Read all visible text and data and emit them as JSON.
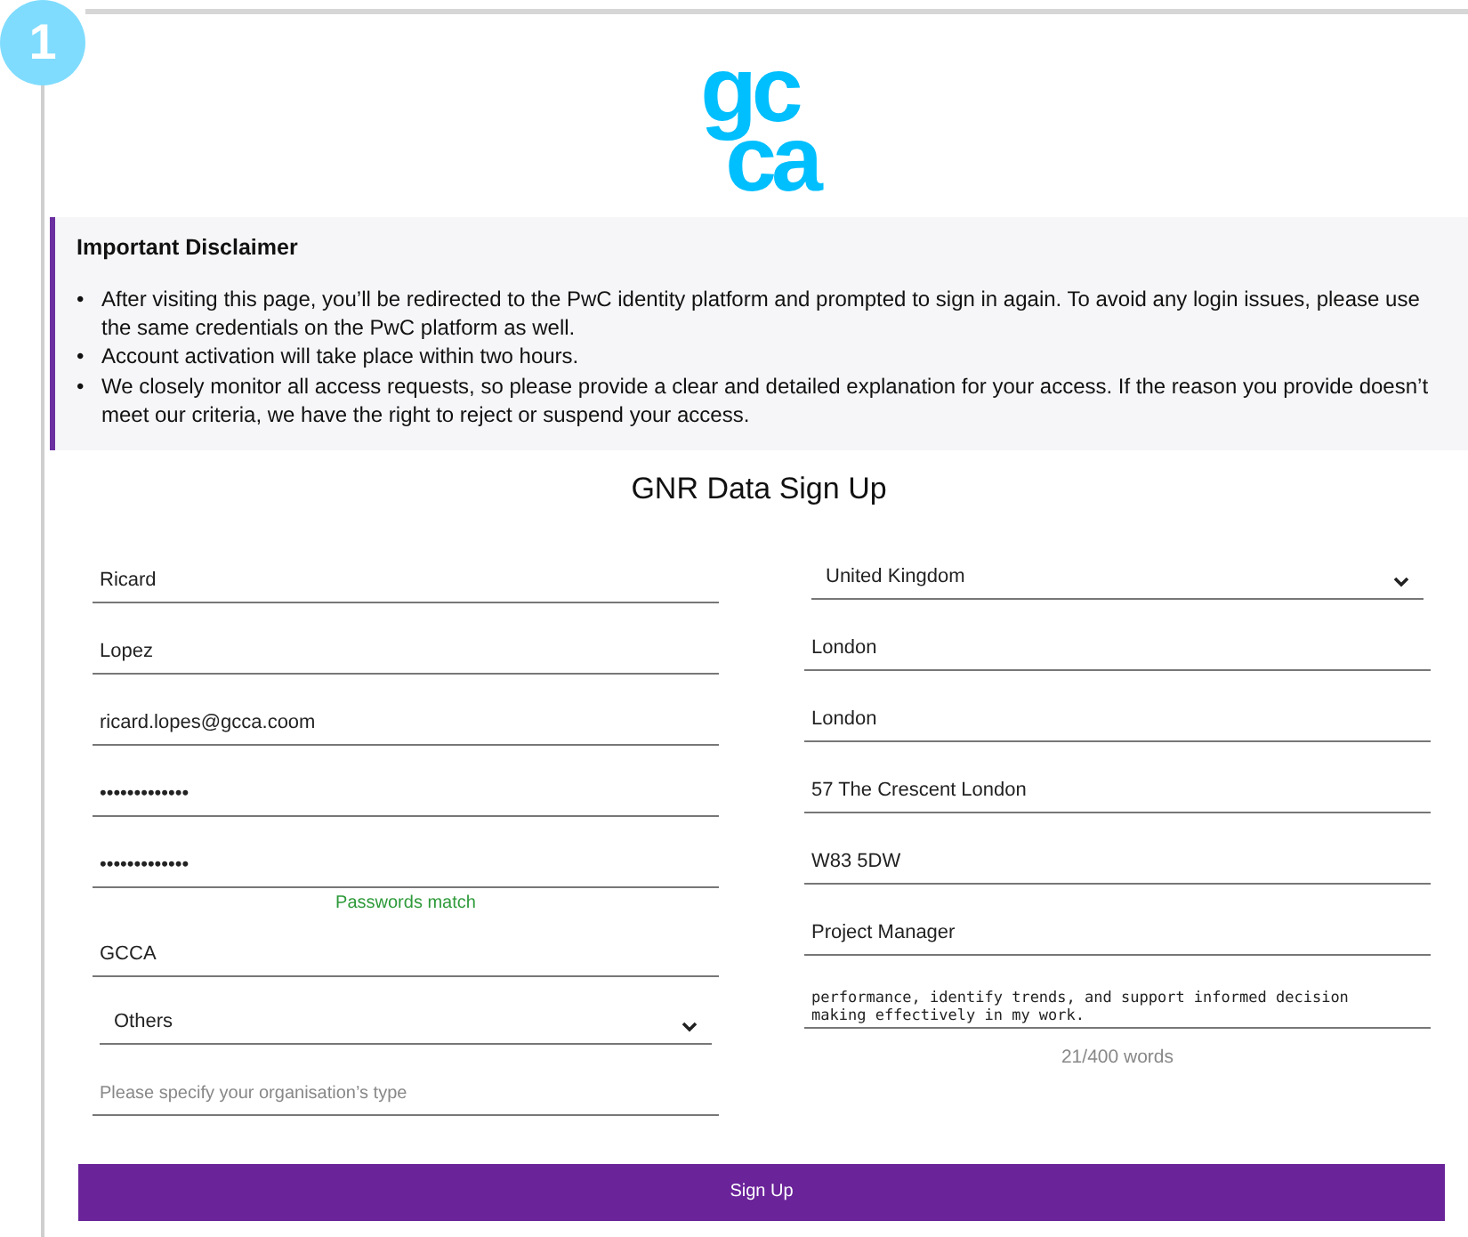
{
  "step_badge": "1",
  "logo": {
    "top": "gc",
    "bottom": "ca"
  },
  "disclaimer": {
    "title": "Important Disclaimer",
    "items": [
      {
        "bullet": "•",
        "text": "After visiting this page, you’ll be redirected to the PwC identity platform and prompted to sign in again. To avoid any login issues, please use the same credentials on the PwC platform as well."
      },
      {
        "bullet": "•",
        "text": "Account activation will take place within two hours."
      },
      {
        "bullet": "•",
        "text": "We closely monitor all access requests, so please provide a clear and detailed explanation for your access. If the reason you provide doesn’t meet our criteria, we have the right to reject or suspend your access."
      }
    ]
  },
  "form_title": "GNR Data Sign Up",
  "left_fields": [
    {
      "kind": "text",
      "value": "Ricard"
    },
    {
      "kind": "text",
      "value": "Lopez"
    },
    {
      "kind": "text",
      "value": "ricard.lopes@gcca.coom"
    },
    {
      "kind": "password",
      "value": "•••••••••••••"
    },
    {
      "kind": "password",
      "value": "•••••••••••••",
      "hint": "Passwords match"
    },
    {
      "kind": "text",
      "value": "GCCA"
    },
    {
      "kind": "select",
      "value": "Others"
    },
    {
      "kind": "text",
      "placeholder": "Please specify your organisation’s type"
    }
  ],
  "right_fields": [
    {
      "kind": "select",
      "value": "United Kingdom"
    },
    {
      "kind": "text",
      "value": "London"
    },
    {
      "kind": "text",
      "value": "London"
    },
    {
      "kind": "text",
      "value": "57 The Crescent London"
    },
    {
      "kind": "text",
      "value": "W83 5DW"
    },
    {
      "kind": "text",
      "value": "Project Manager"
    },
    {
      "kind": "textarea",
      "value": "performance, identify trends, and support informed decision making effectively in my work.",
      "hint": "21/400 words"
    }
  ],
  "submit_button": "Sign Up"
}
